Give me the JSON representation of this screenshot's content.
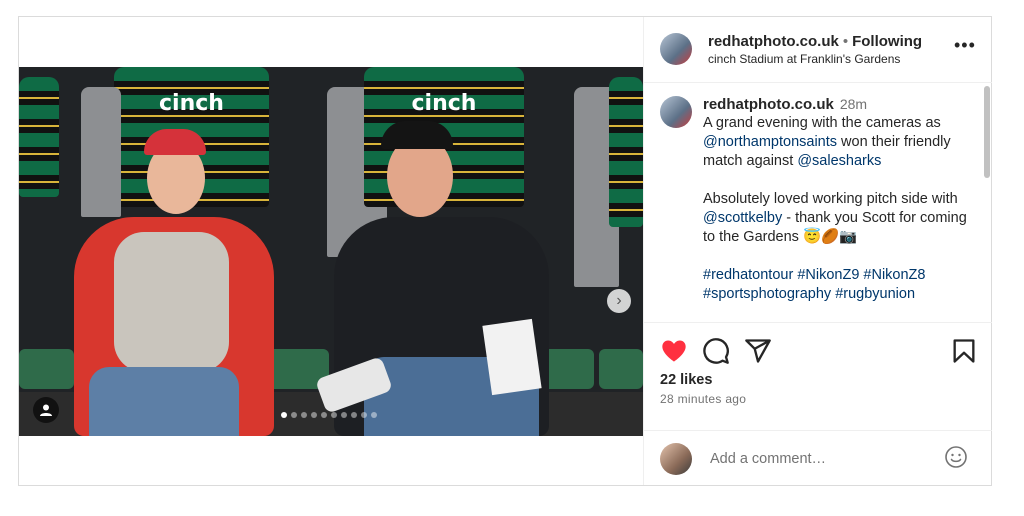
{
  "post": {
    "username": "redhatphoto.co.uk",
    "separator": "•",
    "follow_status": "Following",
    "location": "cinch Stadium at Franklin's Gardens",
    "more_icon": "more-horizontal-icon"
  },
  "media": {
    "jersey_sponsor": "cinch",
    "next_icon": "chevron-right-icon",
    "carousel_count": 10,
    "carousel_active_index": 0,
    "user_tag_icon": "user-tag-icon"
  },
  "caption": {
    "username": "redhatphoto.co.uk",
    "time": "28m",
    "line1_a": "A grand evening with the cameras as ",
    "mention1": "@northamptonsaints",
    "line1_b": " won their friendly match against ",
    "mention2": "@salesharks",
    "line2_a": "Absolutely loved working pitch side with ",
    "mention3": "@scottkelby",
    "line2_b": " - thank you Scott for coming to the Gardens ",
    "emojis": "😇🏉📷",
    "hashtags": "#redhatontour #NikonZ9 #NikonZ8 #sportsphotography #rugbyunion"
  },
  "actions": {
    "like_icon": "heart-filled-icon",
    "comment_icon": "comment-icon",
    "share_icon": "share-icon",
    "save_icon": "bookmark-icon",
    "like_color": "#ff3040"
  },
  "stats": {
    "likes": "22 likes",
    "timestamp": "28 minutes ago"
  },
  "comment": {
    "placeholder": "Add a comment…",
    "emoji_icon": "emoji-smile-icon"
  }
}
